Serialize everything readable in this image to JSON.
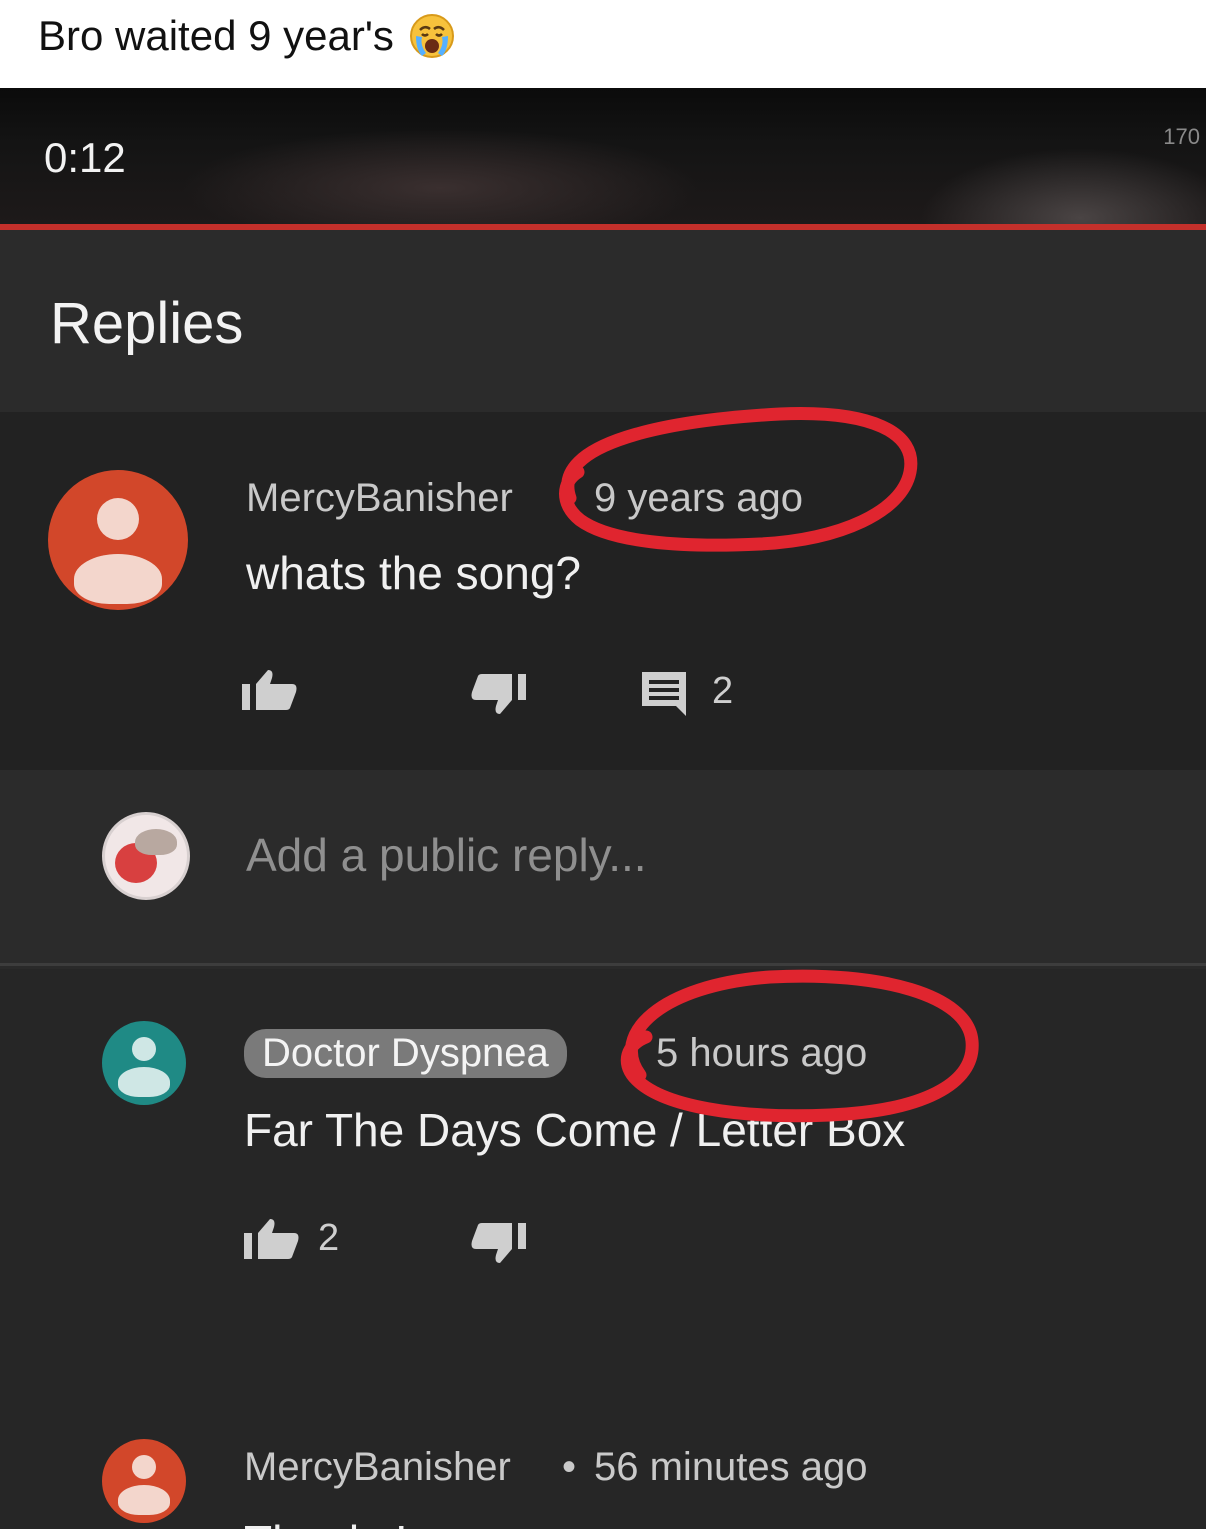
{
  "caption": {
    "text": "Bro waited 9 year's"
  },
  "video": {
    "time": "0:12",
    "corner_text": "170"
  },
  "replies": {
    "title": "Replies"
  },
  "main_comment": {
    "author": "MercyBanisher",
    "time": "9 years ago",
    "text": "whats the song?",
    "reply_count": "2",
    "avatar_color": "#d2472a"
  },
  "add_reply": {
    "placeholder": "Add a public reply..."
  },
  "reply1": {
    "author": "Doctor Dyspnea",
    "time": "5 hours ago",
    "text": "Far The Days Come / Letter Box",
    "like_count": "2",
    "avatar_color": "#1f8a85"
  },
  "reply2": {
    "author": "MercyBanisher",
    "separator": "•",
    "time": "56 minutes ago",
    "text": "Thanks!",
    "avatar_color": "#d2472a"
  },
  "colors": {
    "annotation": "#e0252f",
    "progress": "#c4302b"
  },
  "icons": [
    "crying-emoji-icon",
    "default-avatar-icon",
    "thumbs-up-icon",
    "thumbs-down-icon",
    "reply-comment-icon"
  ]
}
